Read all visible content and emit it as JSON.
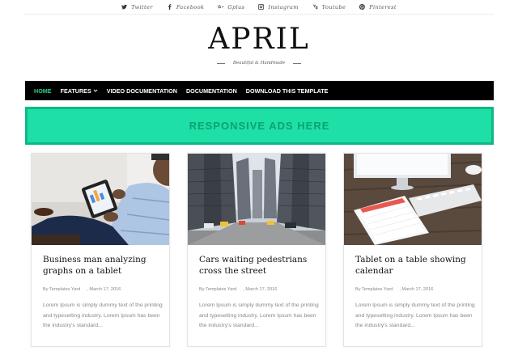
{
  "social": [
    {
      "icon": "twitter-icon",
      "label": "Twitter"
    },
    {
      "icon": "facebook-icon",
      "label": "Facebook"
    },
    {
      "icon": "googleplus-icon",
      "label": "Gplus"
    },
    {
      "icon": "instagram-icon",
      "label": "Instagram"
    },
    {
      "icon": "youtube-icon",
      "label": "Youtube"
    },
    {
      "icon": "pinterest-icon",
      "label": "Pinterest"
    }
  ],
  "header": {
    "logo": "APRIL",
    "tagline": "Beautiful & Handmade"
  },
  "nav": {
    "items": [
      {
        "label": "HOME",
        "active": true
      },
      {
        "label": "FEATURES",
        "dropdown": true
      },
      {
        "label": "VIDEO DOCUMENTATION"
      },
      {
        "label": "DOCUMENTATION"
      },
      {
        "label": "DOWNLOAD THIS TEMPLATE"
      }
    ],
    "active_color": "#2fd07f",
    "background": "#000000"
  },
  "ad": {
    "text": "RESPONSIVE ADS HERE",
    "background": "#1ee0a7"
  },
  "posts": [
    {
      "title": "Business man analyzing graphs on a tablet",
      "author": "By Templates Yard",
      "date": ", March 17, 2016",
      "excerpt": "Lorem Ipsum is simply dummy text of the printing and typesetting industry. Lorem Ipsum has been the industry's standard..."
    },
    {
      "title": "Cars waiting pedestrians cross the street",
      "author": "By Templates Yard",
      "date": ", March 17, 2016",
      "excerpt": "Lorem Ipsum is simply dummy text of the printing and typesetting industry. Lorem Ipsum has been the industry's standard..."
    },
    {
      "title": "Tablet on a table showing calendar",
      "author": "By Templates Yard",
      "date": ", March 17, 2016",
      "excerpt": "Lorem Ipsum is simply dummy text of the printing and typesetting industry. Lorem Ipsum has been the industry's standard..."
    }
  ]
}
